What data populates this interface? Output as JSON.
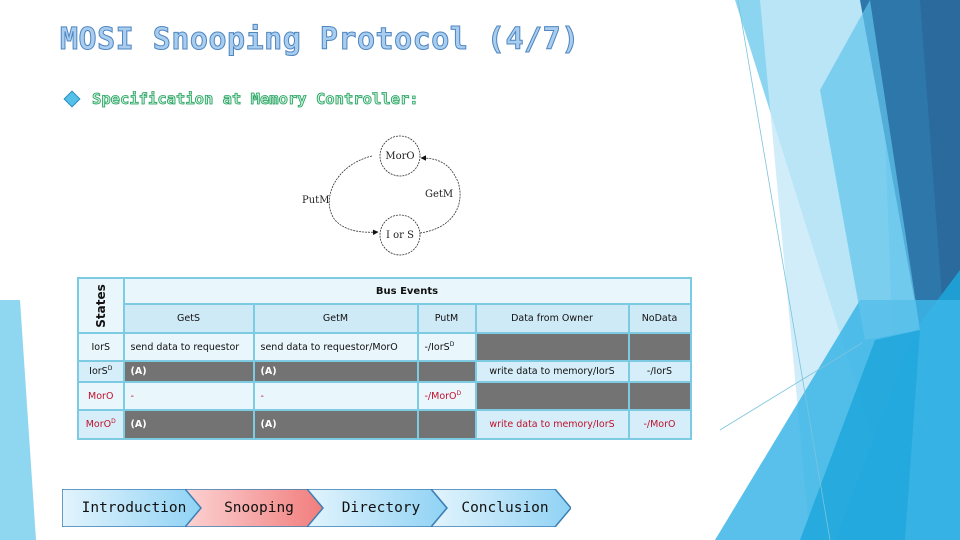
{
  "slide": {
    "title": "MOSI Snooping Protocol (4/7)",
    "bullet": "Specification at Memory Controller:",
    "bullet_icon": "diamond-bullet-icon"
  },
  "diagram": {
    "states": [
      "MorO",
      "I or S"
    ],
    "transitions": [
      {
        "label": "GetM",
        "from": "I or S",
        "to": "MorO"
      },
      {
        "label": "PutM",
        "from": "MorO",
        "to": "I or S"
      }
    ]
  },
  "table": {
    "states_header": "States",
    "bus_events_header": "Bus Events",
    "columns": [
      "GetS",
      "GetM",
      "PutM",
      "Data from Owner",
      "NoData"
    ],
    "rows": [
      {
        "state": "IorS",
        "state_sup": "",
        "cells": [
          "send data to requestor",
          "send data to requestor/MorO",
          "-/IorS",
          "",
          ""
        ],
        "cell_sups": [
          "",
          "",
          "D",
          "",
          ""
        ],
        "dark": [
          false,
          false,
          false,
          true,
          true
        ],
        "red": false
      },
      {
        "state": "IorS",
        "state_sup": "D",
        "cells": [
          "(A)",
          "(A)",
          "",
          "write data to memory/IorS",
          "-/IorS"
        ],
        "cell_sups": [
          "",
          "",
          "",
          "",
          ""
        ],
        "dark": [
          true,
          true,
          true,
          false,
          false
        ],
        "red": false
      },
      {
        "state": "MorO",
        "state_sup": "",
        "cells": [
          "-",
          "-",
          "-/MorO",
          "",
          ""
        ],
        "cell_sups": [
          "",
          "",
          "D",
          "",
          ""
        ],
        "dark": [
          false,
          false,
          false,
          true,
          true
        ],
        "red": true
      },
      {
        "state": "MorO",
        "state_sup": "D",
        "cells": [
          "(A)",
          "(A)",
          "",
          "write data to memory/IorS",
          "-/MorO"
        ],
        "cell_sups": [
          "",
          "",
          "",
          "",
          ""
        ],
        "dark": [
          true,
          true,
          true,
          false,
          false
        ],
        "red": true
      }
    ]
  },
  "nav": {
    "items": [
      {
        "label": "Introduction",
        "active": false
      },
      {
        "label": "Snooping",
        "active": true
      },
      {
        "label": "Directory",
        "active": false
      },
      {
        "label": "Conclusion",
        "active": false
      }
    ]
  },
  "colors": {
    "title_fill": "#a9cdee",
    "title_stroke": "#4f86c0",
    "subtitle_stroke": "#1e9e5a",
    "table_border": "#7ccbe2",
    "dark_cell": "#737373",
    "red_text": "#c0122b",
    "nav_active": "#f27c7c",
    "nav_inactive": "#8fd2f4"
  }
}
